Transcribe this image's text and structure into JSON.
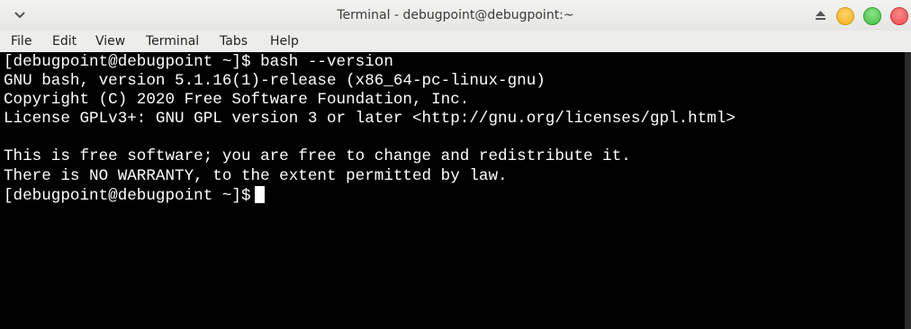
{
  "window": {
    "title": "Terminal - debugpoint@debugpoint:~"
  },
  "menubar": {
    "items": [
      "File",
      "Edit",
      "View",
      "Terminal",
      "Tabs",
      "Help"
    ]
  },
  "terminal": {
    "lines": [
      "[debugpoint@debugpoint ~]$ bash --version",
      "GNU bash, version 5.1.16(1)-release (x86_64-pc-linux-gnu)",
      "Copyright (C) 2020 Free Software Foundation, Inc.",
      "License GPLv3+: GNU GPL version 3 or later <http://gnu.org/licenses/gpl.html>",
      "",
      "This is free software; you are free to change and redistribute it.",
      "There is NO WARRANTY, to the extent permitted by law.",
      "[debugpoint@debugpoint ~]$"
    ]
  },
  "icons": {
    "window_menu": "chevron-down-icon",
    "shade": "eject-icon",
    "minimize": "minimize-icon",
    "maximize": "maximize-icon",
    "close": "close-icon"
  },
  "colors": {
    "terminal_bg": "#000000",
    "terminal_fg": "#ffffff",
    "minimize": "#f2b01e",
    "maximize": "#3fbf3f",
    "close": "#ea4b4b"
  }
}
